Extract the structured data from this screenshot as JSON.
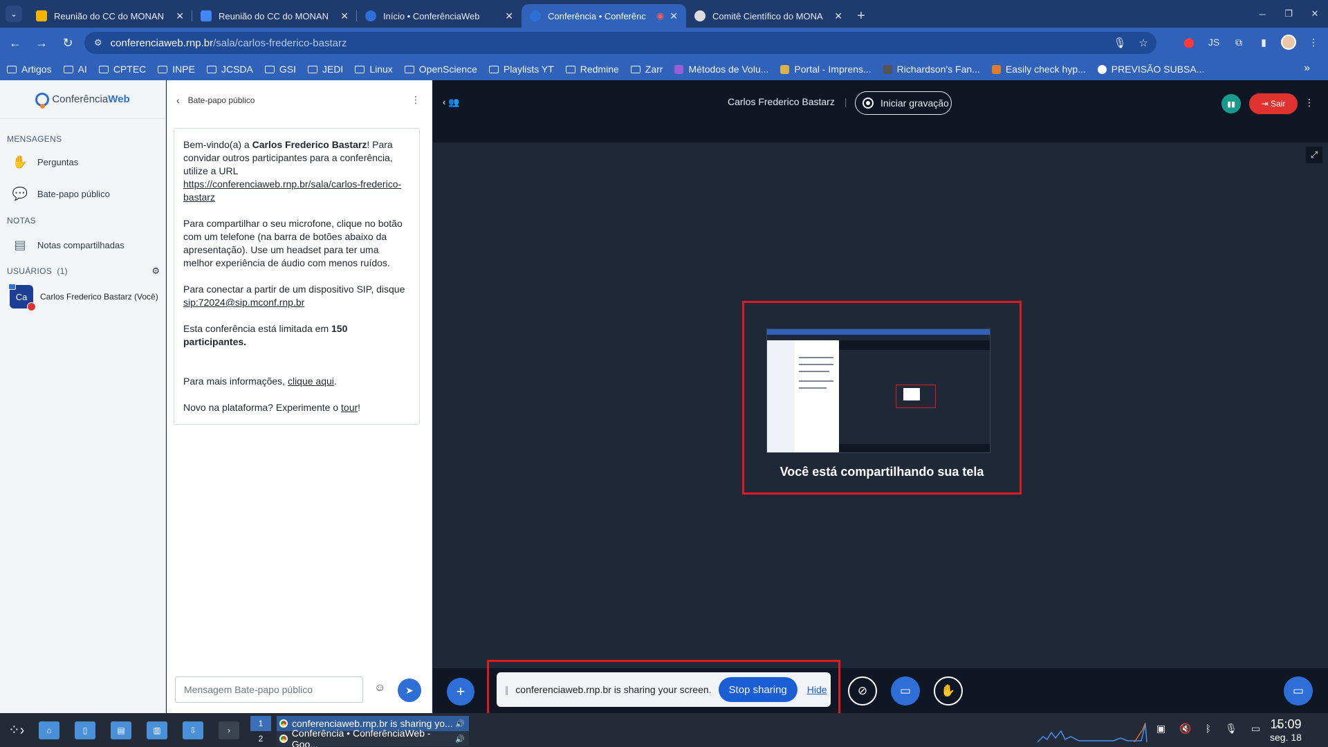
{
  "browser": {
    "tabs": [
      {
        "title": "Reunião do CC do MONAN",
        "color": "#f4b400"
      },
      {
        "title": "Reunião do CC do MONAN",
        "color": "#4285f4"
      },
      {
        "title": "Início • ConferênciaWeb",
        "color": "#2d6fd6"
      },
      {
        "title": "Conferência • Conferênc",
        "color": "#2d6fd6",
        "active": true
      },
      {
        "title": "Comitê Científico do MONA",
        "color": "#444444"
      }
    ],
    "url_host": "conferenciaweb.rnp.br",
    "url_path": "/sala/carlos-frederico-bastarz",
    "bookmarks": [
      "Artigos",
      "AI",
      "CPTEC",
      "INPE",
      "JCSDA",
      "GSI",
      "JEDI",
      "Linux",
      "OpenScience",
      "Playlists YT",
      "Redmine",
      "Zarr",
      "Métodos de Volu...",
      "Portal - Imprens...",
      "Richardson's Fan...",
      "Easily check hyp...",
      "PREVISÃO SUBSA..."
    ]
  },
  "leftnav": {
    "logo_part1": "Conferência",
    "logo_part2": "Web",
    "section_messages": "MENSAGENS",
    "item_questions": "Perguntas",
    "item_public_chat": "Bate-papo público",
    "section_notes": "NOTAS",
    "item_shared_notes": "Notas compartilhadas",
    "section_users": "USUÁRIOS",
    "users_count": "(1)",
    "user_initials": "Ca",
    "user_name": "Carlos Frederico Bastarz (Você)"
  },
  "chat": {
    "title": "Bate-papo público",
    "welcome_intro": "Bem-vindo(a) a ",
    "welcome_room": "Carlos Frederico Bastarz",
    "welcome_invite": "! Para convidar outros participantes para a conferência, utilize a URL",
    "welcome_url": "https://conferenciaweb.rnp.br/sala/carlos-frederico-bastarz",
    "mic_text": "Para compartilhar o seu microfone, clique no botão com um telefone (na barra de botões abaixo da apresentação). Use um headset para ter uma melhor experiência de áudio com menos ruídos.",
    "sip_text": "Para conectar a partir de um dispositivo SIP, disque",
    "sip_address": "sip:72024@sip.mconf.rnp.br",
    "limit_text": "Esta conferência está limitada em ",
    "limit_number": "150",
    "limit_suffix": "participantes",
    "info_text": "Para mais informações, ",
    "info_link": "clique aqui",
    "tour_text": "Novo na plataforma? Experimente o ",
    "tour_link": "tour",
    "input_placeholder": "Mensagem Bate-papo público"
  },
  "meeting": {
    "room_name": "Carlos Frederico Bastarz",
    "record_label": "Iniciar gravação",
    "leave_label": "Sair",
    "sharing_label": "Você está compartilhando sua tela"
  },
  "share_notice": {
    "text": "conferenciaweb.rnp.br is sharing your screen.",
    "stop_label": "Stop sharing",
    "hide_label": "Hide"
  },
  "taskbar": {
    "workspace_1": "1",
    "workspace_2": "2",
    "window_1": "conferenciaweb.rnp.br is sharing yo...",
    "window_2": "Conferência • ConferênciaWeb - Goo...",
    "time": "15:09",
    "date": "seg. 18"
  }
}
